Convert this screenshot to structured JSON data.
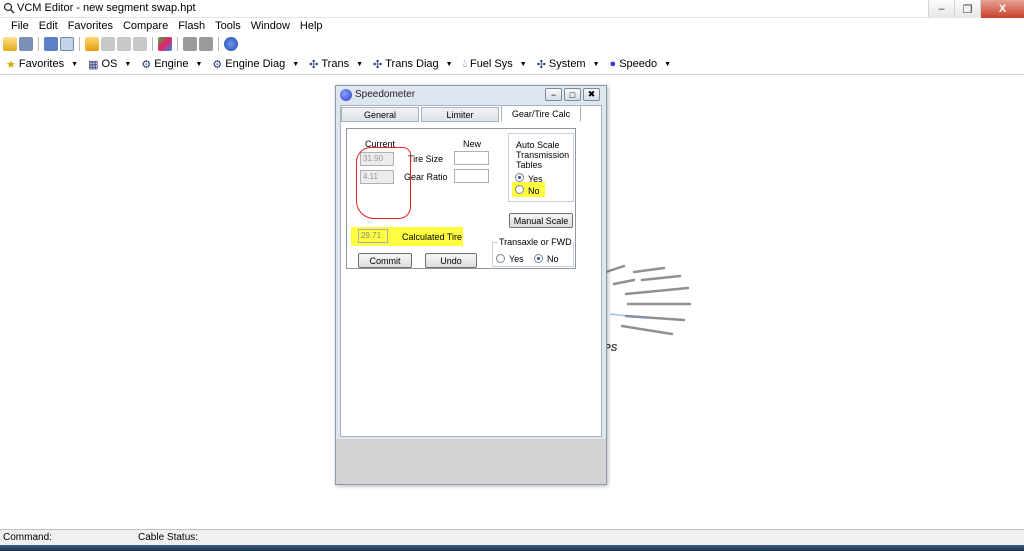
{
  "window": {
    "title": "VCM Editor - new segment swap.hpt",
    "buttons": {
      "minimize": "‒",
      "maximize": "❐",
      "close": "X"
    }
  },
  "menu": [
    "File",
    "Edit",
    "Favorites",
    "Compare",
    "Flash",
    "Tools",
    "Window",
    "Help"
  ],
  "toolbar_icons": [
    "open-icon",
    "save-icon",
    "properties-icon",
    "document-icon",
    "new-folder-icon",
    "grid-icon",
    "grid-icon",
    "grid-icon",
    "compare-icon",
    "read-icon",
    "write-icon",
    "info-icon"
  ],
  "modules": [
    {
      "label": "Favorites",
      "icon": "star-icon"
    },
    {
      "label": "OS",
      "icon": "chip-icon"
    },
    {
      "label": "Engine",
      "icon": "engine-icon"
    },
    {
      "label": "Engine Diag",
      "icon": "engine-icon"
    },
    {
      "label": "Trans",
      "icon": "gear-icon"
    },
    {
      "label": "Trans Diag",
      "icon": "gear-icon"
    },
    {
      "label": "Fuel Sys",
      "icon": "fuel-drop-icon"
    },
    {
      "label": "System",
      "icon": "gear-icon"
    },
    {
      "label": "Speedo",
      "icon": "speedo-icon"
    }
  ],
  "dialog": {
    "title": "Speedometer",
    "buttons": {
      "minimize": "−",
      "maximize": "□",
      "close": "✖"
    },
    "tabs": [
      {
        "label": "General",
        "active": false
      },
      {
        "label": "Limiter",
        "active": false
      },
      {
        "label": "Gear/Tire Calc",
        "active": true
      }
    ],
    "columns": {
      "current": "Current",
      "new": "New"
    },
    "tire_size": {
      "label": "Tire Size",
      "current": "31.90",
      "new": ""
    },
    "gear_ratio": {
      "label": "Gear Ratio",
      "current": "4.11",
      "new": ""
    },
    "auto_scale": {
      "title_line1": "Auto Scale",
      "title_line2": "Transmission",
      "title_line3": "Tables",
      "yes_label": "Yes",
      "no_label": "No",
      "selected": "Yes"
    },
    "manual_scale_label": "Manual Scale",
    "calculated_tire": {
      "value": "29.71",
      "label": "Calculated Tire"
    },
    "transaxle": {
      "title": "Transaxle or FWD",
      "yes_label": "Yes",
      "no_label": "No",
      "selected": "No"
    },
    "commit_label": "Commit",
    "undo_label": "Undo"
  },
  "background_gauge": {
    "text": "PS"
  },
  "status": {
    "command": "Command:",
    "cable": "Cable Status:"
  },
  "colors": {
    "highlight": "#ffff40",
    "annotation_circle": "#e21f26",
    "taskbar": "#1d3353"
  }
}
